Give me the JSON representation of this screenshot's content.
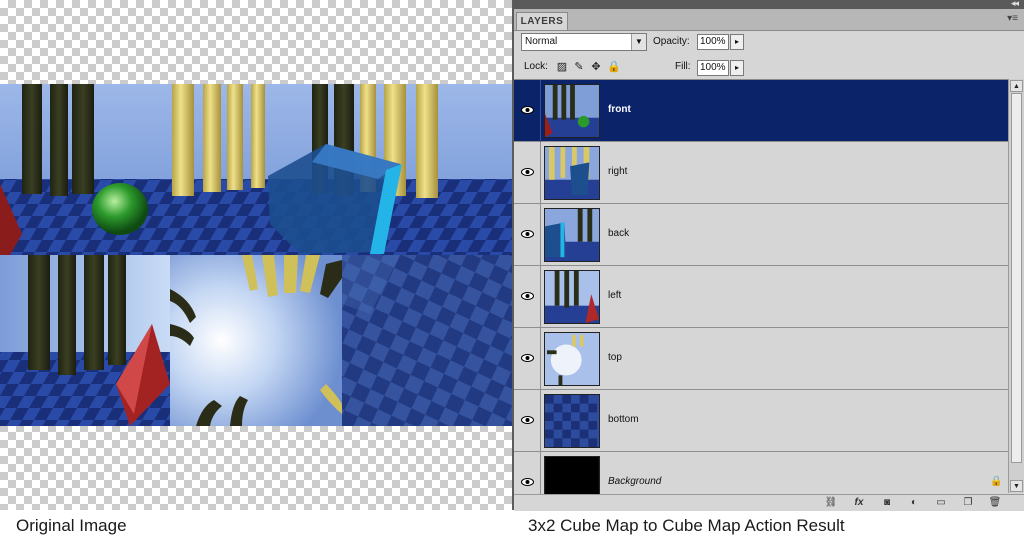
{
  "captions": {
    "left": "Original Image",
    "right": "3x2 Cube Map to Cube Map Action Result"
  },
  "panel": {
    "tab_label": "LAYERS",
    "blend_mode": "Normal",
    "opacity_label": "Opacity:",
    "opacity_value": "100%",
    "lock_label": "Lock:",
    "fill_label": "Fill:",
    "fill_value": "100%",
    "lock_icons": [
      "lock-transparent-icon",
      "lock-paint-icon",
      "lock-move-icon",
      "lock-all-icon"
    ],
    "layers": [
      {
        "name": "front",
        "selected": true,
        "visible": true
      },
      {
        "name": "right",
        "selected": false,
        "visible": true
      },
      {
        "name": "back",
        "selected": false,
        "visible": true
      },
      {
        "name": "left",
        "selected": false,
        "visible": true
      },
      {
        "name": "top",
        "selected": false,
        "visible": true
      },
      {
        "name": "bottom",
        "selected": false,
        "visible": true
      },
      {
        "name": "Background",
        "selected": false,
        "visible": true,
        "locked": true
      }
    ],
    "bottom_icons": [
      "link-layers-icon",
      "fx-icon",
      "add-mask-icon",
      "adjustment-layer-icon",
      "new-group-icon",
      "new-layer-icon",
      "trash-icon"
    ],
    "colors": {
      "selected_row": "#0b2369",
      "panel_bg": "#d6d6d6"
    }
  }
}
